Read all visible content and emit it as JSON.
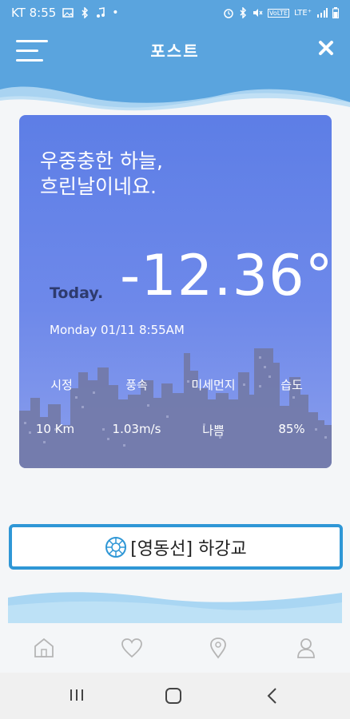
{
  "status_bar": {
    "carrier_time": "KT 8:55",
    "notification_icons": [
      "image-icon",
      "bluetooth-app-icon",
      "music-icon",
      "dot-icon"
    ],
    "system_icons": [
      "alarm-icon",
      "bluetooth-icon",
      "mute-icon",
      "volte-icon",
      "lte-signal-icon",
      "battery-icon"
    ],
    "volte_text": "VoLTE",
    "lte_text": "LTE⁺"
  },
  "header": {
    "title": "포스트",
    "menu_icon": "hamburger-icon",
    "close_icon": "close-icon"
  },
  "weather_card": {
    "sky_line1": "우중충한 하늘,",
    "sky_line2": "흐린날이네요.",
    "today_label": "Today.",
    "temperature": "-12.36°",
    "datetime": "Monday 01/11 8:55AM",
    "stats": [
      {
        "label": "시정",
        "value": "10 Km"
      },
      {
        "label": "풍속",
        "value": "1.03m/s"
      },
      {
        "label": "미세먼지",
        "value": "나쁨"
      },
      {
        "label": "습도",
        "value": "85%"
      }
    ]
  },
  "route": {
    "label": "[영동선] 하강교",
    "icon": "highway-emblem-icon"
  },
  "tab_bar": {
    "items": [
      "home-icon",
      "heart-icon",
      "location-pin-icon",
      "user-icon"
    ]
  },
  "colors": {
    "header_blue": "#5aa4de",
    "card_top": "#5d7ee6",
    "route_border": "#2f97d6"
  }
}
